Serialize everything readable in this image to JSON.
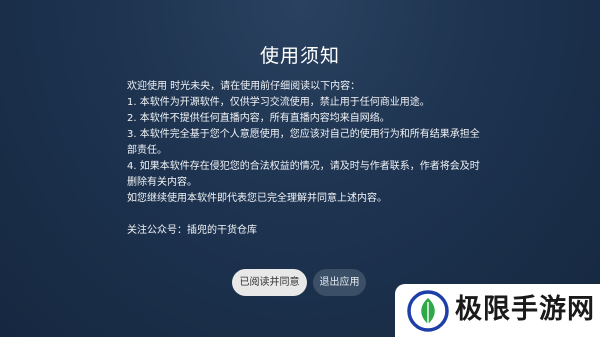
{
  "dialog": {
    "title": "使用须知",
    "lines": [
      "欢迎使用 时光未央，请在使用前仔细阅读以下内容：",
      "1. 本软件为开源软件，仅供学习交流使用，禁止用于任何商业用途。",
      "2. 本软件不提供任何直播内容，所有直播内容均来自网络。",
      "3. 本软件完全基于您个人意愿使用，您应该对自己的使用行为和所有结果承担全部责任。",
      "4. 如果本软件存在侵犯您的合法权益的情况，请及时与作者联系，作者将会及时删除有关内容。",
      "如您继续使用本软件即代表您已完全理解并同意上述内容。"
    ],
    "follow_text": "关注公众号：插兜的干货仓库",
    "agree_label": "已阅读并同意",
    "exit_label": "退出应用"
  },
  "watermark": {
    "text": "极限手游网",
    "logo_icon": "leaf-logo-icon"
  },
  "colors": {
    "background": "#1d3350",
    "agree_button": "#e8e8e8",
    "exit_button": "#3b4f66",
    "logo_blue": "#1e3fa8",
    "logo_green": "#2fa84a"
  }
}
